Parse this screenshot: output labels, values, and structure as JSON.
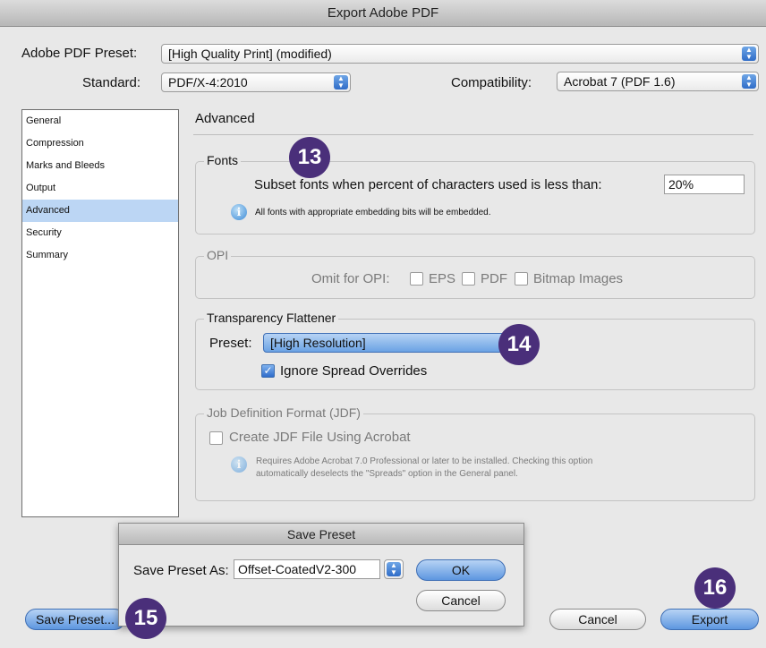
{
  "window": {
    "title": "Export Adobe PDF"
  },
  "top": {
    "preset_label": "Adobe PDF Preset:",
    "preset_value": "[High Quality Print] (modified)",
    "standard_label": "Standard:",
    "standard_value": "PDF/X-4:2010",
    "compat_label": "Compatibility:",
    "compat_value": "Acrobat 7 (PDF 1.6)"
  },
  "sidebar": {
    "items": [
      {
        "label": "General"
      },
      {
        "label": "Compression"
      },
      {
        "label": "Marks and Bleeds"
      },
      {
        "label": "Output"
      },
      {
        "label": "Advanced",
        "selected": true
      },
      {
        "label": "Security"
      },
      {
        "label": "Summary"
      }
    ]
  },
  "main": {
    "title": "Advanced",
    "fonts": {
      "title": "Fonts",
      "subset_label": "Subset fonts when percent of characters used is less than:",
      "subset_value": "20%",
      "info": "All fonts with appropriate embedding bits will be embedded."
    },
    "opi": {
      "title": "OPI",
      "omit_label": "Omit for OPI:",
      "eps": "EPS",
      "pdf": "PDF",
      "bitmap": "Bitmap Images"
    },
    "transparency": {
      "title": "Transparency Flattener",
      "preset_label": "Preset:",
      "preset_value": "[High Resolution]",
      "ignore_label": "Ignore Spread Overrides"
    },
    "jdf": {
      "title": "Job Definition Format (JDF)",
      "create_label": "Create JDF File Using Acrobat",
      "info_line1": "Requires Adobe Acrobat 7.0 Professional or later to be installed. Checking this option",
      "info_line2": "automatically deselects the \"Spreads\" option in the General panel."
    }
  },
  "badges": {
    "b13": "13",
    "b14": "14",
    "b15": "15",
    "b16": "16"
  },
  "bottom": {
    "save_preset": "Save Preset...",
    "cancel": "Cancel",
    "export": "Export"
  },
  "dialog": {
    "title": "Save Preset",
    "label": "Save Preset As:",
    "value": "Offset-CoatedV2-300",
    "ok": "OK",
    "cancel": "Cancel"
  },
  "colors": {
    "badge": "#4a2f7a",
    "accent": "#5d96e0",
    "selection": "#bcd6f4"
  }
}
